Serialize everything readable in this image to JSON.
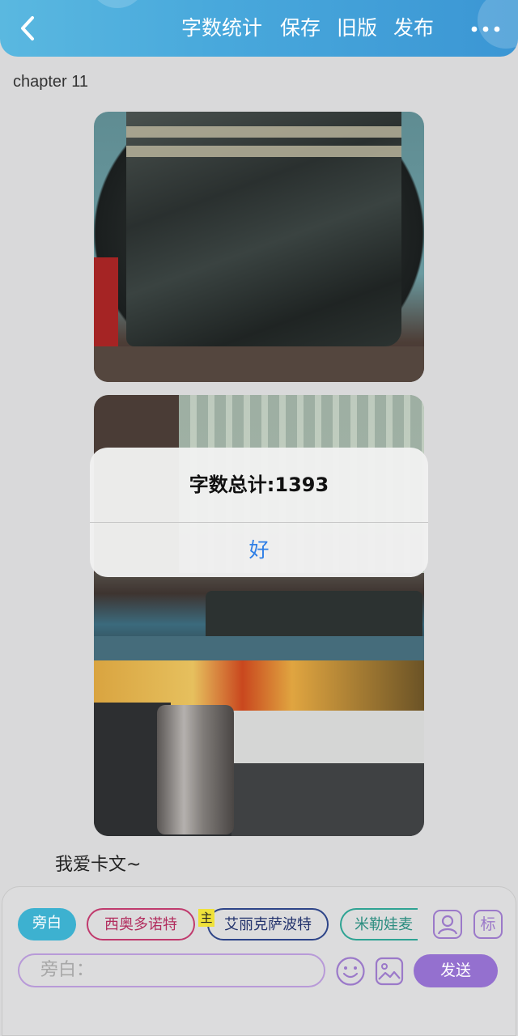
{
  "header": {
    "back_icon": "chevron-left-icon",
    "word_count_label": "字数统计",
    "save_label": "保存",
    "old_version_label": "旧版",
    "publish_label": "发布",
    "more_icon": "more-dots-icon"
  },
  "content": {
    "chapter_title": "chapter 11",
    "narration_text": "我爱卡文~"
  },
  "alert": {
    "title": "字数总计:1393",
    "ok_label": "好"
  },
  "composer": {
    "narration_chip": "旁白",
    "characters": [
      "西奥多诺特",
      "艾丽克萨波特",
      "米勒娃麦"
    ],
    "main_badge": "主",
    "avatar_icon": "character-avatar-icon",
    "tag_label": "标",
    "input_placeholder": "旁白：",
    "emoji_icon": "emoji-icon",
    "image_icon": "image-icon",
    "send_label": "发送"
  },
  "colors": {
    "header_accent": "#49a9dc",
    "narration_chip": "#3db1d0",
    "send_button": "#9470cf",
    "alert_button_text": "#2f7fe6"
  }
}
